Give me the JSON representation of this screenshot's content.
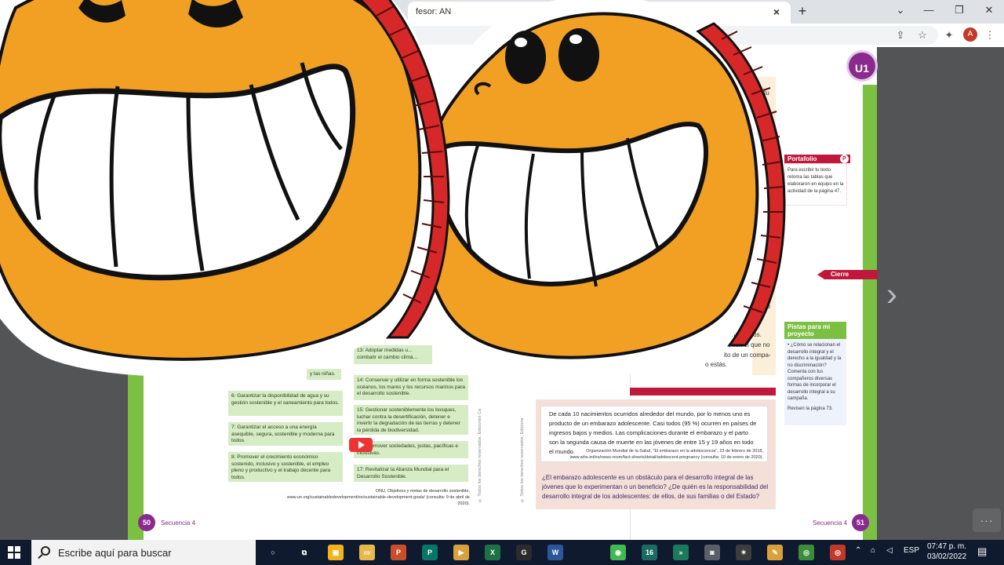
{
  "browser": {
    "tab_title": "fesor: AN",
    "close_tab": "×",
    "new_tab": "+",
    "minimize": "—",
    "restore": "❐",
    "close_window": "✕",
    "share_icon": "⇪",
    "star_icon": "☆",
    "extensions_icon": "✦",
    "profile_initial": "A",
    "menu_icon": "⋮",
    "chevron": "⌄"
  },
  "book": {
    "unit_badge": "U1",
    "right_snippets": [
      "en tu",
      "des",
      "ar",
      "do"
    ],
    "mid_text": {
      "line1": "mpañeros.",
      "line2": ", con el que no",
      "line3": "ito de un compa-",
      "line4": "o estás."
    },
    "portafolio": {
      "title": "Portafolio",
      "badge": "P",
      "body": "Para escribir tu texto retoma las tablas que elaboraron en equipo en la actividad de la página 47."
    },
    "cierre": "Cierre",
    "pistas": {
      "title": "Pistas para mi proyecto",
      "body": "• ¿Cómo se relacionan el desarrollo integral y el derecho a la igualdad y la no discriminación? Comenta con tus compañeros diversas formas de incorporar el desarrollo integral a su campaña.",
      "footer": "Revisen la página 73."
    },
    "quote": {
      "text": "De cada 10 nacimientos ocurridos alrededor del mundo, por lo menos uno es producto de un embarazo adolescente. Casi todos (95 %) ocurren en países de ingresos bajos y medios. Las complicaciones durante el embarazo y el parto son la segunda causa de muerte en las jóvenes de entre 15 y 19 años en todo el mundo.",
      "source": "Organización Mundial de la Salud, \"El embarazo en la adolescencia\", 23 de febrero de 2018, www.who.int/es/news-room/fact-sheets/detail/adolescent-pregnancy (consulta: 10 de enero de 2020)."
    },
    "question": "¿El embarazo adolescente es un obstáculo para el desarrollo integral de las jóvenes que lo experimentan o un beneficio? ¿De quién es la responsabilidad del desarrollo integral de los adolescentes: de ellos, de sus familias o del Estado?",
    "goals": [
      {
        "text": "y las niñas."
      },
      {
        "text": "13: Adoptar medidas u... combatir el cambio climá..."
      },
      {
        "text": "14: Conservar y utilizar en forma sostenible los océanos, los mares y los recursos marinos para el desarrollo sostenible."
      },
      {
        "text": "6: Garantizar la disponibilidad de agua y su gestión sostenible y el saneamiento para todos."
      },
      {
        "text": "15: Gestionar sosteniblemente los bosques, luchar contra la desertificación, detener e invertir la degradación de las tierras y detener la pérdida de biodiversidad."
      },
      {
        "text": "7: Garantizar el acceso a una energía asequible, segura, sostenible y moderna para todos."
      },
      {
        "text": "16: Promover sociedades, justas, pacíficas e inclusivas."
      },
      {
        "text": "8: Promover el crecimiento económico sostenido, inclusivo y sostenible, el empleo pleno y productivo y el trabajo decente para todos."
      },
      {
        "text": "17: Revitalizar la Alianza Mundial para el Desarrollo Sostenible."
      }
    ],
    "source_left": "ONU, Objetivos y metas de desarrollo sostenible, www.un.org/sustainabledevelopment/es/sustainable-development-goals/ (consulta: 9 de abril de 2020).",
    "vertical_left": "© Todos los derechos reservados, Ediciones Ca",
    "vertical_right": "© Todos los derechos reservados, Edicione",
    "page_left": "50",
    "page_right": "51",
    "section_left": "Secuencia 4",
    "section_right": "Secuencia 4"
  },
  "viewer": {
    "next_arrow": "›",
    "more": "···"
  },
  "taskbar": {
    "search_placeholder": "Escribe aquí para buscar",
    "lang": "ESP",
    "time": "07:47 p. m.",
    "date": "03/02/2022",
    "apps": [
      {
        "name": "cortana",
        "glyph": "○",
        "color": "#0f1a2e"
      },
      {
        "name": "task-view",
        "glyph": "⧉",
        "color": "#0f1a2e"
      },
      {
        "name": "store",
        "glyph": "▣",
        "color": "#f3b21b"
      },
      {
        "name": "file-explorer",
        "glyph": "▭",
        "color": "#e8b94a"
      },
      {
        "name": "powerpoint",
        "glyph": "P",
        "color": "#c94f2c"
      },
      {
        "name": "publisher",
        "glyph": "P",
        "color": "#077568"
      },
      {
        "name": "media-player",
        "glyph": "▶",
        "color": "#d9a13b"
      },
      {
        "name": "excel",
        "glyph": "X",
        "color": "#1e7145"
      },
      {
        "name": "pdf-app",
        "glyph": "G",
        "color": "#2b2b2b"
      },
      {
        "name": "word",
        "glyph": "W",
        "color": "#2b579a"
      },
      {
        "name": "maps-pin",
        "glyph": "◉",
        "color": "#3fb950"
      },
      {
        "name": "terminal-app",
        "glyph": "16",
        "color": "#1c6b63"
      },
      {
        "name": "media-app",
        "glyph": "»",
        "color": "#1b7a5c"
      },
      {
        "name": "camera",
        "glyph": "◙",
        "color": "#5a5f68"
      },
      {
        "name": "inkscape",
        "glyph": "✶",
        "color": "#3c3c3c"
      },
      {
        "name": "paint",
        "glyph": "✎",
        "color": "#d9a13b"
      },
      {
        "name": "chrome",
        "glyph": "◎",
        "color": "#3c8d3a"
      },
      {
        "name": "chrome-profile",
        "glyph": "◎",
        "color": "#c0392b"
      }
    ]
  },
  "colors": {
    "accent_purple": "#8a2a8f",
    "book_green": "#7bc043",
    "book_red": "#c0183a",
    "sticker_orange": "#f2a024"
  }
}
